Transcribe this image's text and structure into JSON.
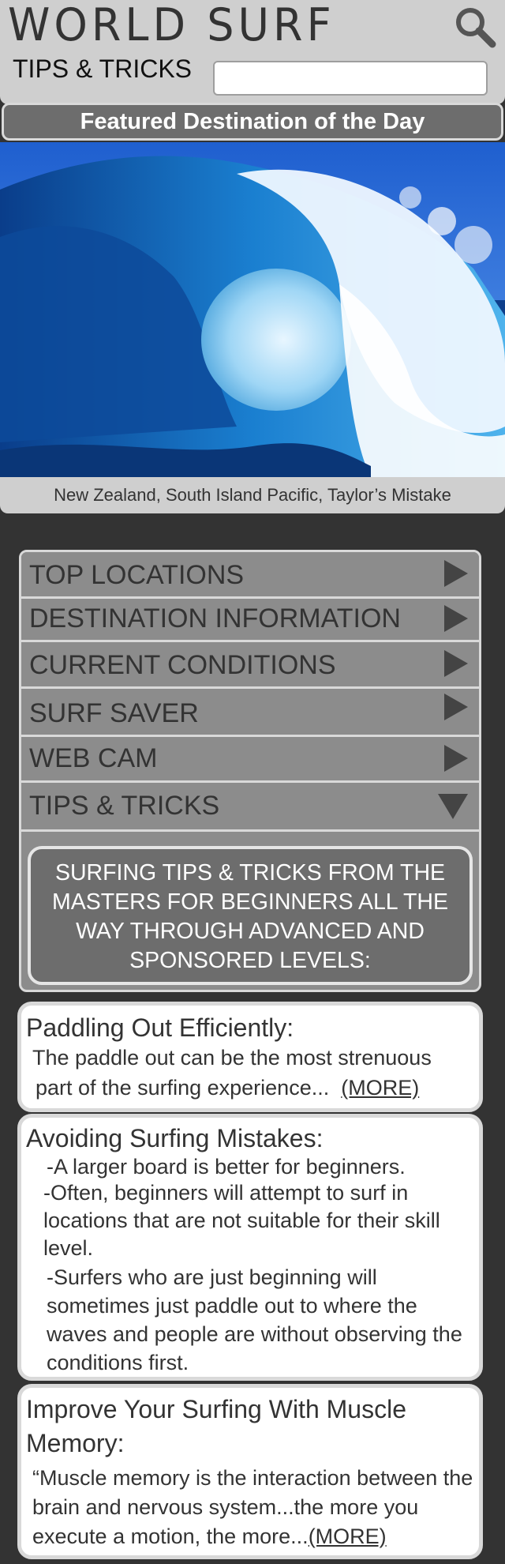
{
  "header": {
    "title": "WORLD SURF",
    "subtitle": "TIPS & TRICKS",
    "search_placeholder": "",
    "search_icon": "search-icon"
  },
  "featured": {
    "heading": "Featured Destination of the Day",
    "image": "ocean-wave-image",
    "caption": "New Zealand, South Island Pacific, Taylor’s Mistake"
  },
  "menu": {
    "items": [
      {
        "label": "TOP LOCATIONS",
        "icon": "arrow-right-icon"
      },
      {
        "label": "DESTINATION INFORMATION",
        "icon": "arrow-right-icon"
      },
      {
        "label": "CURRENT CONDITIONS",
        "icon": "arrow-right-icon"
      },
      {
        "label": "SURF SAVER",
        "icon": "arrow-right-icon"
      },
      {
        "label": "WEB CAM",
        "icon": "arrow-right-icon"
      },
      {
        "label": "TIPS & TRICKS",
        "icon": "arrow-down-icon"
      }
    ],
    "tips_intro": "SURFING TIPS & TRICKS FROM THE MASTERS FOR BEGINNERS ALL THE WAY THROUGH ADVANCED AND SPONSORED LEVELS:"
  },
  "cards": {
    "paddling": {
      "title": "Paddling Out Efficiently:",
      "line1": "The paddle out can be the most strenuous",
      "line2": "part of the surfing experience...",
      "more": "(MORE)"
    },
    "mistakes": {
      "title": "Avoiding Surfing Mistakes:",
      "tip1": "-A larger board is better for beginners.",
      "tip2": "-Often, beginners will attempt to surf in locations that are not suitable for their skill level.",
      "tip3": "-Surfers who are just beginning will sometimes just paddle out to where the waves and people are without observing the conditions first."
    },
    "muscle": {
      "title": "Improve Your Surfing With Muscle Memory:",
      "text": "“Muscle memory is the interaction between the brain and nervous system...the more you execute a motion, the more...",
      "more": "(MORE)"
    }
  }
}
